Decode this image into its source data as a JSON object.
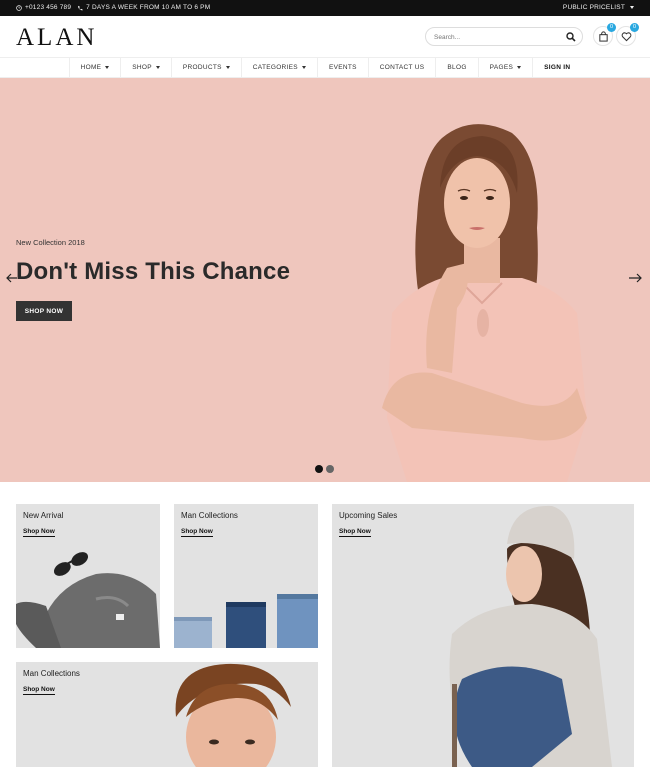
{
  "topbar": {
    "phone": "+0123 456 789",
    "hours": "7 DAYS A WEEK FROM 10 AM TO 6 PM",
    "pricelist": "PUBLIC PRICELIST"
  },
  "header": {
    "logo": "ALAN",
    "search_placeholder": "Search...",
    "cart_count": "0",
    "wishlist_count": "0"
  },
  "nav": {
    "items": [
      {
        "label": "HOME",
        "dropdown": true
      },
      {
        "label": "SHOP",
        "dropdown": true
      },
      {
        "label": "PRODUCTS",
        "dropdown": true
      },
      {
        "label": "CATEGORIES",
        "dropdown": true
      },
      {
        "label": "EVENTS",
        "dropdown": false
      },
      {
        "label": "CONTACT US",
        "dropdown": false
      },
      {
        "label": "BLOG",
        "dropdown": false
      },
      {
        "label": "PAGES",
        "dropdown": true
      },
      {
        "label": "SIGN IN",
        "dropdown": false
      }
    ]
  },
  "hero": {
    "subtitle": "New Collection 2018",
    "title": "Don't Miss This Chance",
    "button": "SHOP NOW",
    "background": "#efc6bd",
    "slides": 2,
    "active_slide": 1
  },
  "banners": [
    {
      "title": "New Arrival",
      "link": "Shop Now"
    },
    {
      "title": "Man Collections",
      "link": "Shop Now"
    },
    {
      "title": "Upcoming Sales",
      "link": "Shop Now"
    },
    {
      "title": "Man Collections",
      "link": "Shop Now"
    }
  ],
  "colors": {
    "accent": "#29a8e0",
    "dark": "#333333",
    "banner_bg": "#e2e2e2"
  }
}
